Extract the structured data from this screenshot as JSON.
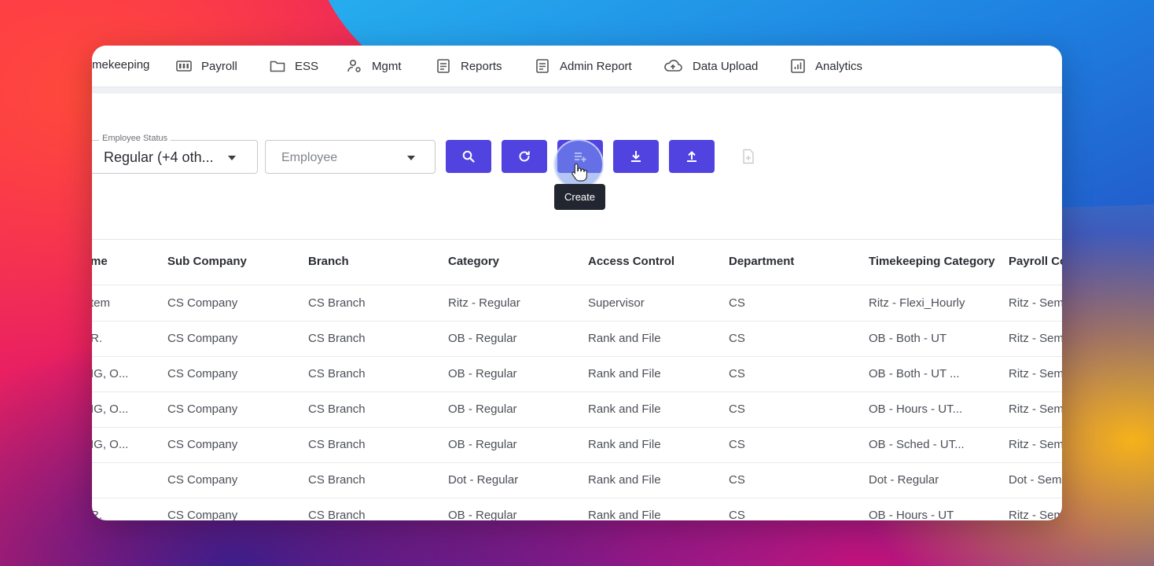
{
  "nav": {
    "items": [
      {
        "label": "mekeeping",
        "icon": "clock-icon"
      },
      {
        "label": "Payroll",
        "icon": "money-icon"
      },
      {
        "label": "ESS",
        "icon": "folder-icon"
      },
      {
        "label": "Mgmt",
        "icon": "user-gear-icon"
      },
      {
        "label": "Reports",
        "icon": "document-icon"
      },
      {
        "label": "Admin Report",
        "icon": "document-icon"
      },
      {
        "label": "Data Upload",
        "icon": "cloud-upload-icon"
      },
      {
        "label": "Analytics",
        "icon": "bar-chart-icon"
      }
    ]
  },
  "filters": {
    "employee_status_label": "Employee Status",
    "employee_status_value": "Regular (+4 oth...",
    "employee_placeholder": "Employee"
  },
  "toolbar": {
    "tooltip": "Create",
    "accent_color": "#5043e0"
  },
  "table": {
    "headers": [
      "me",
      "Sub Company",
      "Branch",
      "Category",
      "Access Control",
      "Department",
      "Timekeeping Category",
      "Payroll Co"
    ],
    "rows": [
      [
        "tem",
        "CS Company",
        "CS Branch",
        "Ritz - Regular",
        "Supervisor",
        "CS",
        "Ritz - Flexi_Hourly",
        "Ritz - Sem"
      ],
      [
        "R.",
        "CS Company",
        "CS Branch",
        "OB - Regular",
        "Rank and File",
        "CS",
        "OB - Both - UT",
        "Ritz - Sem"
      ],
      [
        "IG, O...",
        "CS Company",
        "CS Branch",
        "OB - Regular",
        "Rank and File",
        "CS",
        "OB - Both - UT ...",
        "Ritz - Sem"
      ],
      [
        "IG, O...",
        "CS Company",
        "CS Branch",
        "OB - Regular",
        "Rank and File",
        "CS",
        "OB - Hours - UT...",
        "Ritz - Sem"
      ],
      [
        "IG, O...",
        "CS Company",
        "CS Branch",
        "OB - Regular",
        "Rank and File",
        "CS",
        "OB - Sched - UT...",
        "Ritz - Sem"
      ],
      [
        "",
        "CS Company",
        "CS Branch",
        "Dot - Regular",
        "Rank and File",
        "CS",
        "Dot - Regular",
        "Dot - Sem"
      ],
      [
        "R.",
        "CS Company",
        "CS Branch",
        "OB - Regular",
        "Rank and File",
        "CS",
        "OB - Hours - UT",
        "Ritz - Sem"
      ]
    ]
  }
}
